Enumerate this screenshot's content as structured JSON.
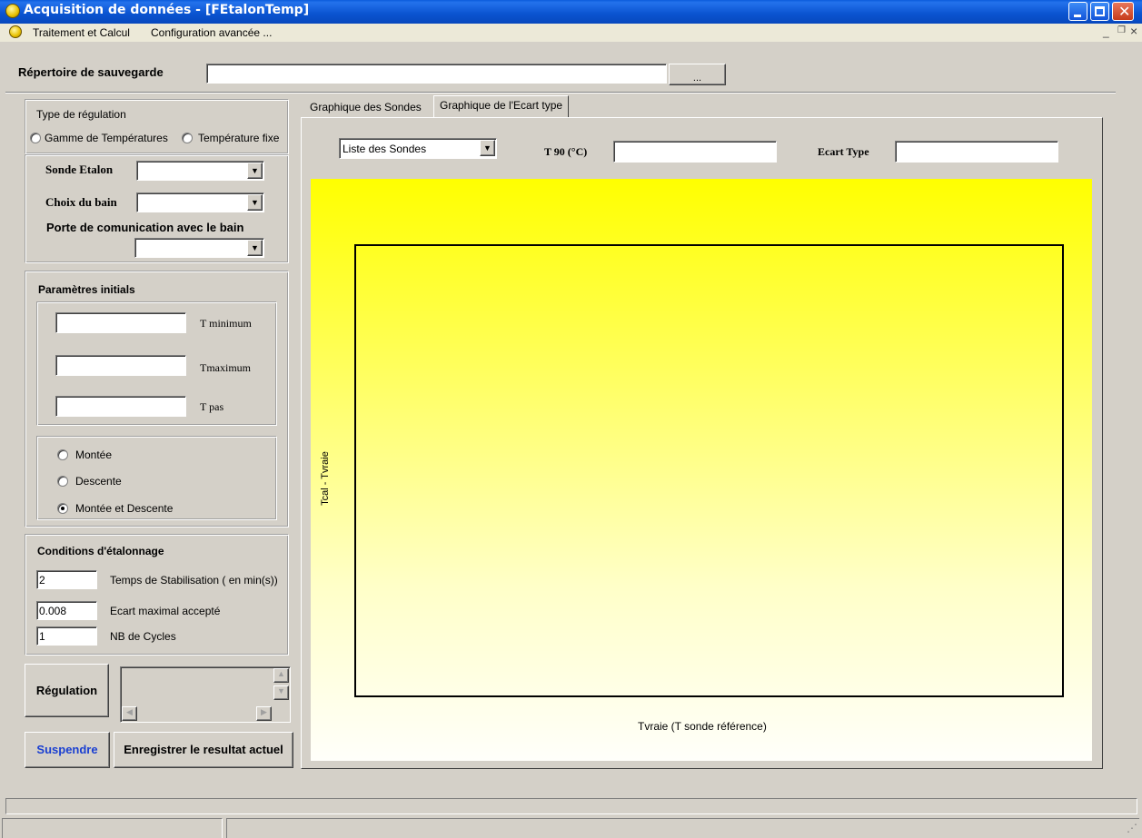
{
  "window": {
    "title": "Acquisition de données - [FEtalonTemp]",
    "icon": "bulb-icon"
  },
  "menu": {
    "items": [
      "Traitement et Calcul",
      "Configuration avancée ..."
    ],
    "mdi_controls": [
      "_",
      "❐",
      "×"
    ]
  },
  "toolbar": {
    "save_dir_label": "Répertoire de sauvegarde",
    "save_dir_value": "",
    "browse_label": "..."
  },
  "regulation": {
    "group_label": "Type de régulation",
    "radio_range": "Gamme de Températures",
    "radio_fixed": "Température fixe",
    "sonde_label": "Sonde Etalon",
    "bain_label": "Choix du bain",
    "port_label": "Porte de comunication avec le bain"
  },
  "params": {
    "group_label": "Paramètres initials",
    "tmin_label": "T minimum",
    "tmax_label": "Tmaximum",
    "tpas_label": "T pas",
    "tmin_value": "",
    "tmax_value": "",
    "tpas_value": "",
    "mode_up": "Montée",
    "mode_down": "Descente",
    "mode_both": "Montée et Descente",
    "selected_mode": "Montée et Descente"
  },
  "conditions": {
    "group_label": "Conditions d'étalonnage",
    "stab_value": "2",
    "stab_label": "Temps de Stabilisation ( en min(s))",
    "ecart_value": "0.008",
    "ecart_label": "Ecart maximal accepté",
    "cycles_value": "1",
    "cycles_label": "NB de Cycles"
  },
  "actions": {
    "regulation_label": "Régulation",
    "suspend_label": "Suspendre",
    "save_label": "Enregistrer le resultat actuel"
  },
  "tabs": {
    "tab1": "Graphique des Sondes",
    "tab2": "Graphique de l'Ecart type",
    "active": "Graphique de l'Ecart type"
  },
  "graph": {
    "probe_select": "Liste des Sondes",
    "t90_label": "T 90 (°C)",
    "t90_value": "",
    "ecart_type_label": "Ecart Type",
    "ecart_type_value": ""
  },
  "chart_data": {
    "type": "scatter",
    "title": "",
    "xlabel": "Tvraie (T sonde référence)",
    "ylabel": "Tcal - Tvraie",
    "series": [],
    "grid": false,
    "background": [
      "#ffff00",
      "#fffffa"
    ]
  },
  "colors": {
    "titlebar": "#0a53d0",
    "suspend_text": "#1a3fd1"
  }
}
